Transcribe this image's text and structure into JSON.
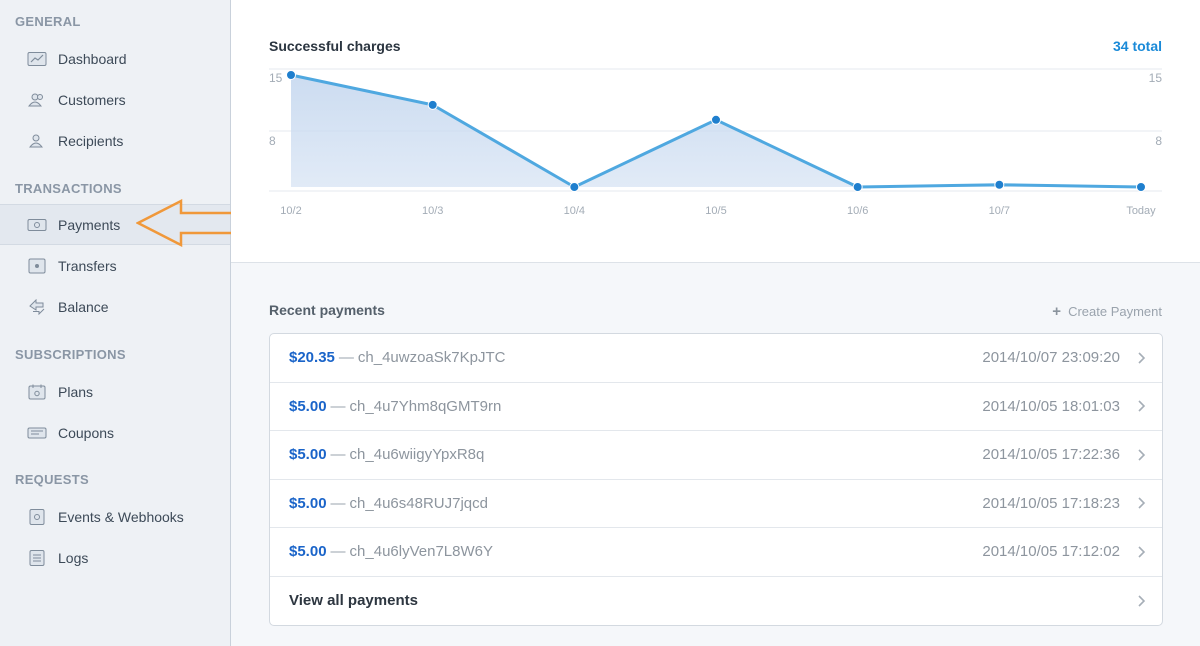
{
  "sidebar": {
    "sections": [
      {
        "title": "GENERAL",
        "items": [
          {
            "label": "Dashboard",
            "icon": "dashboard-icon"
          },
          {
            "label": "Customers",
            "icon": "customers-icon"
          },
          {
            "label": "Recipients",
            "icon": "recipients-icon"
          }
        ]
      },
      {
        "title": "TRANSACTIONS",
        "items": [
          {
            "label": "Payments",
            "icon": "payments-icon",
            "active": true
          },
          {
            "label": "Transfers",
            "icon": "transfers-icon"
          },
          {
            "label": "Balance",
            "icon": "balance-icon"
          }
        ]
      },
      {
        "title": "SUBSCRIPTIONS",
        "items": [
          {
            "label": "Plans",
            "icon": "plans-icon"
          },
          {
            "label": "Coupons",
            "icon": "coupons-icon"
          }
        ]
      },
      {
        "title": "REQUESTS",
        "items": [
          {
            "label": "Events & Webhooks",
            "icon": "events-icon"
          },
          {
            "label": "Logs",
            "icon": "logs-icon"
          }
        ]
      }
    ]
  },
  "annotation": {
    "icon": "orange-arrow-icon",
    "color": "#f0983a"
  },
  "chart": {
    "title": "Successful charges",
    "total": "34 total"
  },
  "chart_data": {
    "type": "area",
    "title": "Successful charges",
    "categories": [
      "10/2",
      "10/3",
      "10/4",
      "10/5",
      "10/6",
      "10/7",
      "Today"
    ],
    "values": [
      15,
      11,
      0,
      9,
      0,
      0.3,
      0
    ],
    "yticks": [
      15,
      8
    ],
    "ylim": [
      0,
      15
    ],
    "grid": true,
    "line_color": "#4fa8e0",
    "fill_color": "#c9daf0"
  },
  "recent": {
    "title": "Recent payments",
    "create_label": "Create Payment",
    "payments": [
      {
        "amount": "$20.35",
        "id": "ch_4uwzoaSk7KpJTC",
        "time": "2014/10/07 23:09:20"
      },
      {
        "amount": "$5.00",
        "id": "ch_4u7Yhm8qGMT9rn",
        "time": "2014/10/05 18:01:03"
      },
      {
        "amount": "$5.00",
        "id": "ch_4u6wiigyYpxR8q",
        "time": "2014/10/05 17:22:36"
      },
      {
        "amount": "$5.00",
        "id": "ch_4u6s48RUJ7jqcd",
        "time": "2014/10/05 17:18:23"
      },
      {
        "amount": "$5.00",
        "id": "ch_4u6lyVen7L8W6Y",
        "time": "2014/10/05 17:12:02"
      }
    ],
    "separator": "—",
    "view_all": "View all payments"
  },
  "colors": {
    "accent": "#1a64c9",
    "total": "#1a8ad8"
  }
}
